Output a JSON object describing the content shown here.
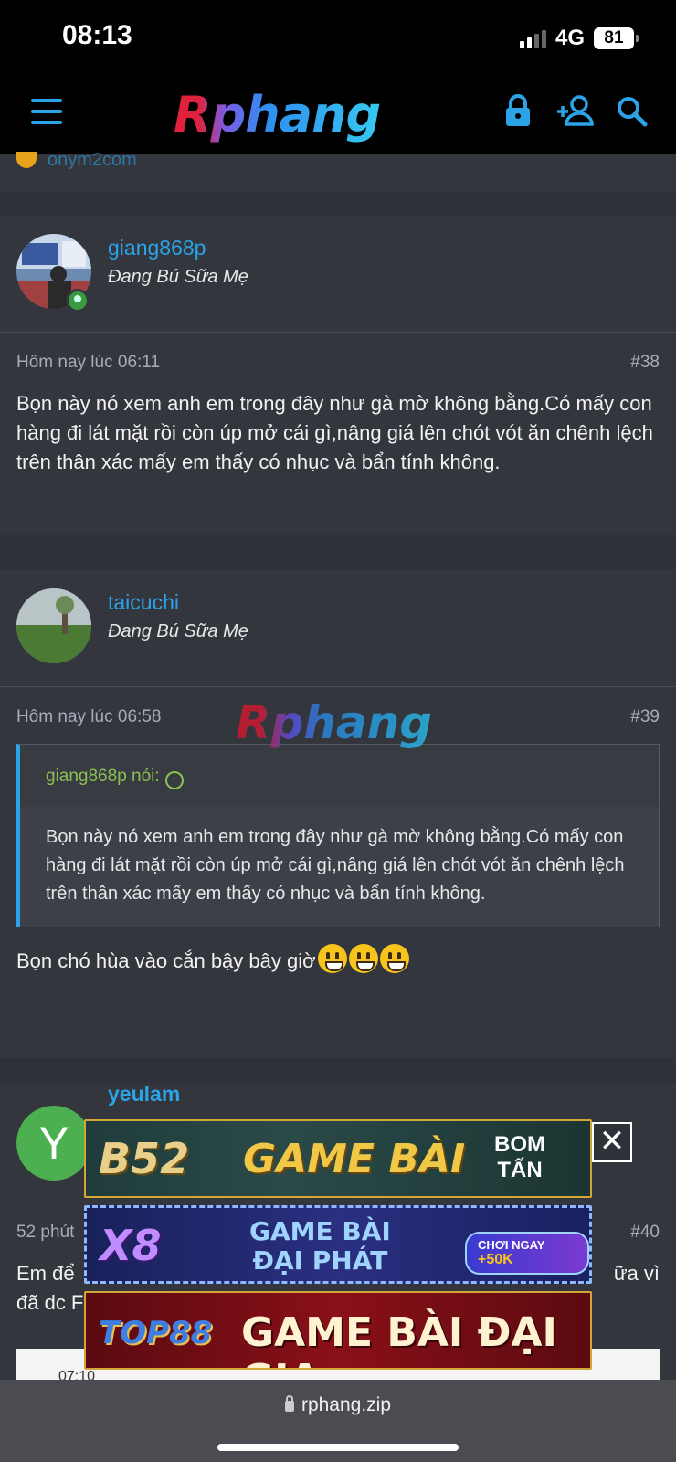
{
  "status_bar": {
    "time": "08:13",
    "network": "4G",
    "battery": "81"
  },
  "header": {
    "logo_text": "Rphang",
    "icons": [
      "menu-icon",
      "lock-icon",
      "add-user-icon",
      "search-icon"
    ],
    "accent_color": "#2ba3e6"
  },
  "partial_top": {
    "username": "onym2com"
  },
  "posts": [
    {
      "username": "giang868p",
      "user_title": "Đang Bú Sữa Mẹ",
      "time": "Hôm nay lúc 06:11",
      "number": "#38",
      "body": "Bọn này nó xem anh em trong đây như gà mờ không bằng.Có mấy con hàng đi lát mặt rồi còn úp mở cái gì,nâng giá lên chót vót ăn chênh lệch trên thân xác mấy em thấy có nhục và bẩn tính không."
    },
    {
      "username": "taicuchi",
      "user_title": "Đang Bú Sữa Mẹ",
      "time": "Hôm nay lúc 06:58",
      "number": "#39",
      "quote_author": "giang868p nói:",
      "quote_body": "Bọn này nó xem anh em trong đây như gà mờ không bằng.Có mấy con hàng đi lát mặt rồi còn úp mở cái gì,nâng giá lên chót vót ăn chênh lệch trên thân xác mấy em thấy có nhục và bẩn tính không.",
      "body": "Bọn chó hùa vào cắn bậy bây giờ"
    },
    {
      "username": "yeulam",
      "avatar_letter": "Y",
      "time": "52 phút",
      "number": "#40",
      "body_line1_start": "Em để",
      "body_line1_end": "ữa vì",
      "body_line2_start": "đã dc F",
      "image_strip_text": "07:10"
    }
  ],
  "watermark": "Rphang",
  "ads": [
    {
      "brand": "B52",
      "text": "GAME BÀI",
      "sub": "BOM TẤN"
    },
    {
      "brand": "X8",
      "text_line1": "GAME BÀI",
      "text_line2": "ĐẠI PHÁT",
      "cta": "CHƠI NGAY",
      "bonus": "+50K"
    },
    {
      "brand": "TOP88",
      "text": "GAME BÀI ĐẠI GIA"
    }
  ],
  "ad_close": "✕",
  "browser": {
    "url": "rphang.zip"
  }
}
